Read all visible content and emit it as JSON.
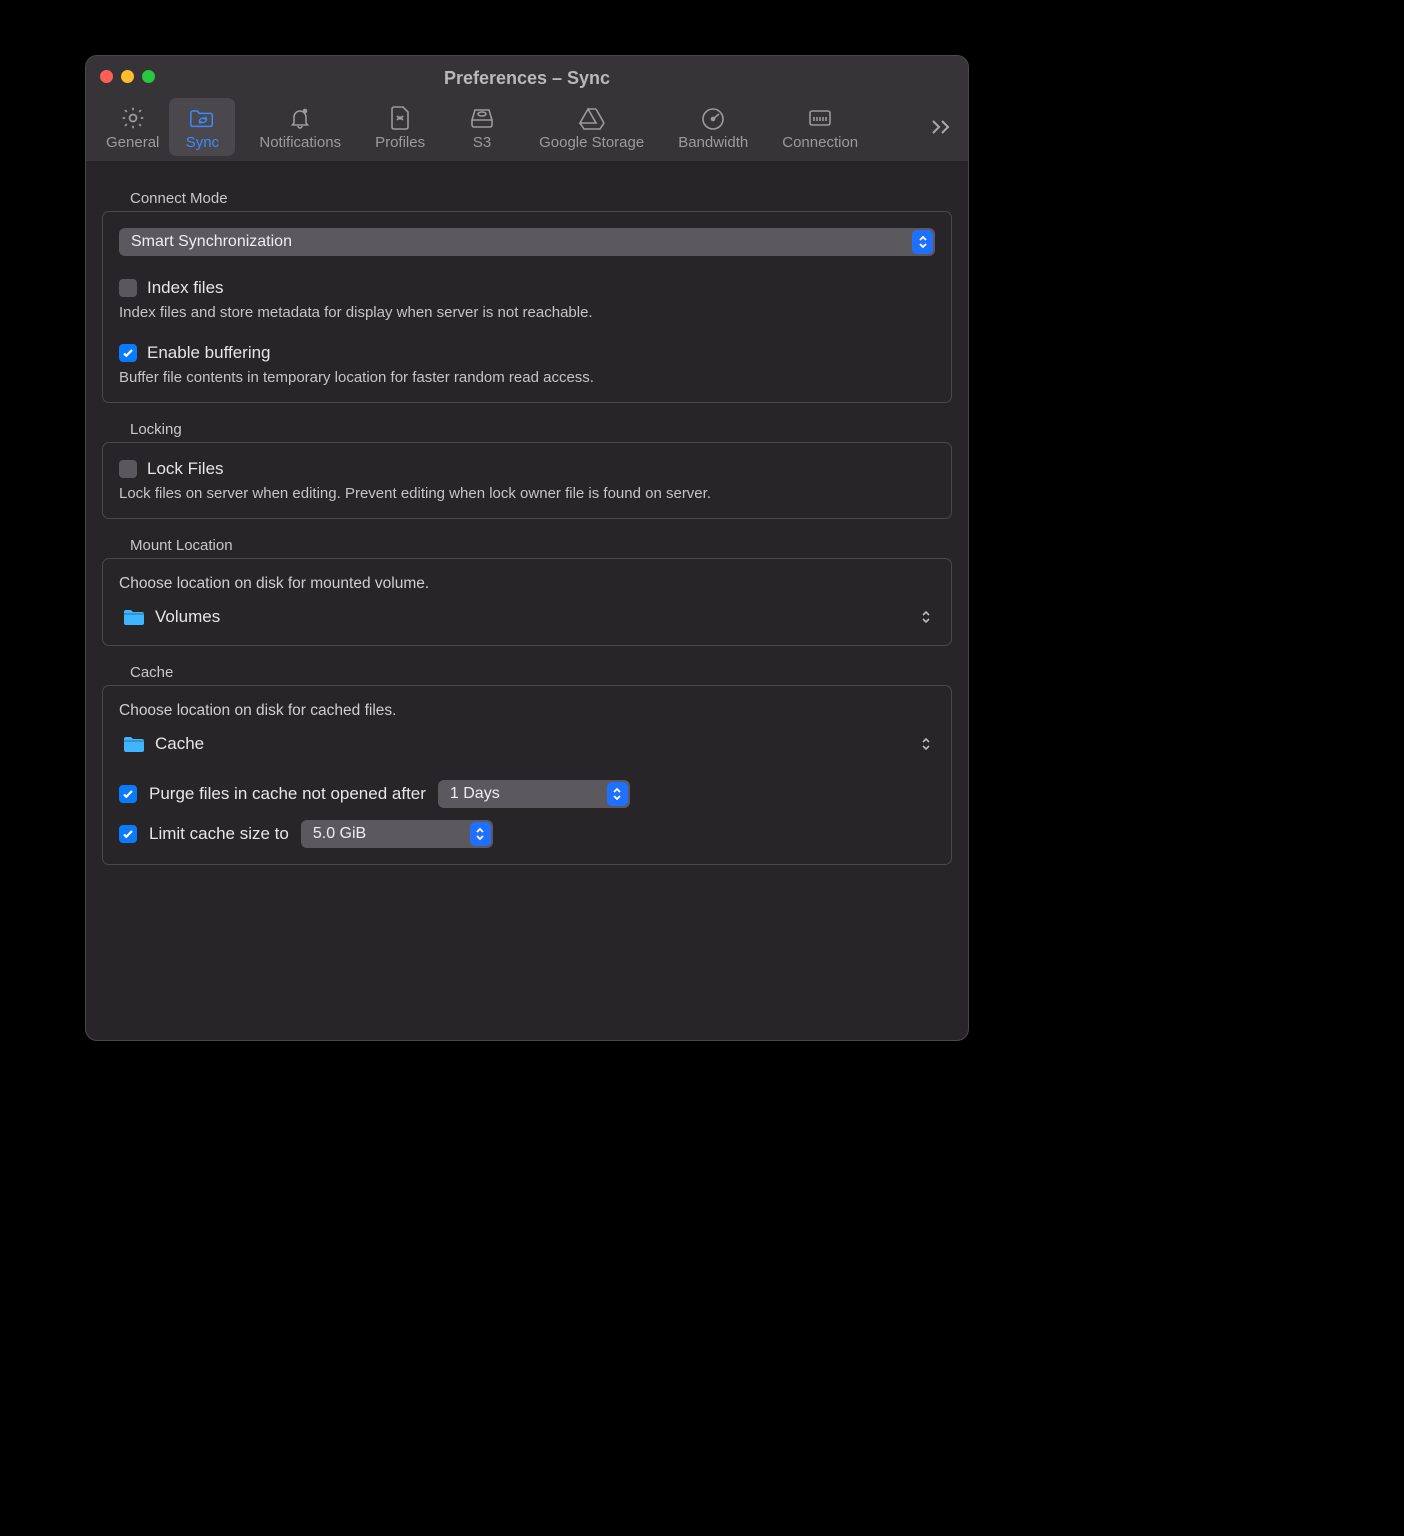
{
  "window": {
    "title": "Preferences – Sync"
  },
  "toolbar": {
    "items": [
      {
        "label": "General"
      },
      {
        "label": "Sync"
      },
      {
        "label": "Notifications"
      },
      {
        "label": "Profiles"
      },
      {
        "label": "S3"
      },
      {
        "label": "Google Storage"
      },
      {
        "label": "Bandwidth"
      },
      {
        "label": "Connection"
      }
    ]
  },
  "connectMode": {
    "section": "Connect Mode",
    "selected": "Smart Synchronization",
    "indexFiles": {
      "checked": false,
      "label": "Index files",
      "desc": "Index files and store metadata for display when server is not reachable."
    },
    "enableBuffering": {
      "checked": true,
      "label": "Enable buffering",
      "desc": "Buffer file contents in temporary location for faster random read access."
    }
  },
  "locking": {
    "section": "Locking",
    "lockFiles": {
      "checked": false,
      "label": "Lock Files",
      "desc": "Lock files on server when editing. Prevent editing when lock owner file is found on server."
    }
  },
  "mount": {
    "section": "Mount Location",
    "note": "Choose location on disk for mounted volume.",
    "folder": "Volumes"
  },
  "cache": {
    "section": "Cache",
    "note": "Choose location on disk for cached files.",
    "folder": "Cache",
    "purge": {
      "checked": true,
      "label": "Purge files in cache not opened after",
      "value": "1 Days"
    },
    "limit": {
      "checked": true,
      "label": "Limit cache size to",
      "value": "5.0 GiB"
    }
  }
}
